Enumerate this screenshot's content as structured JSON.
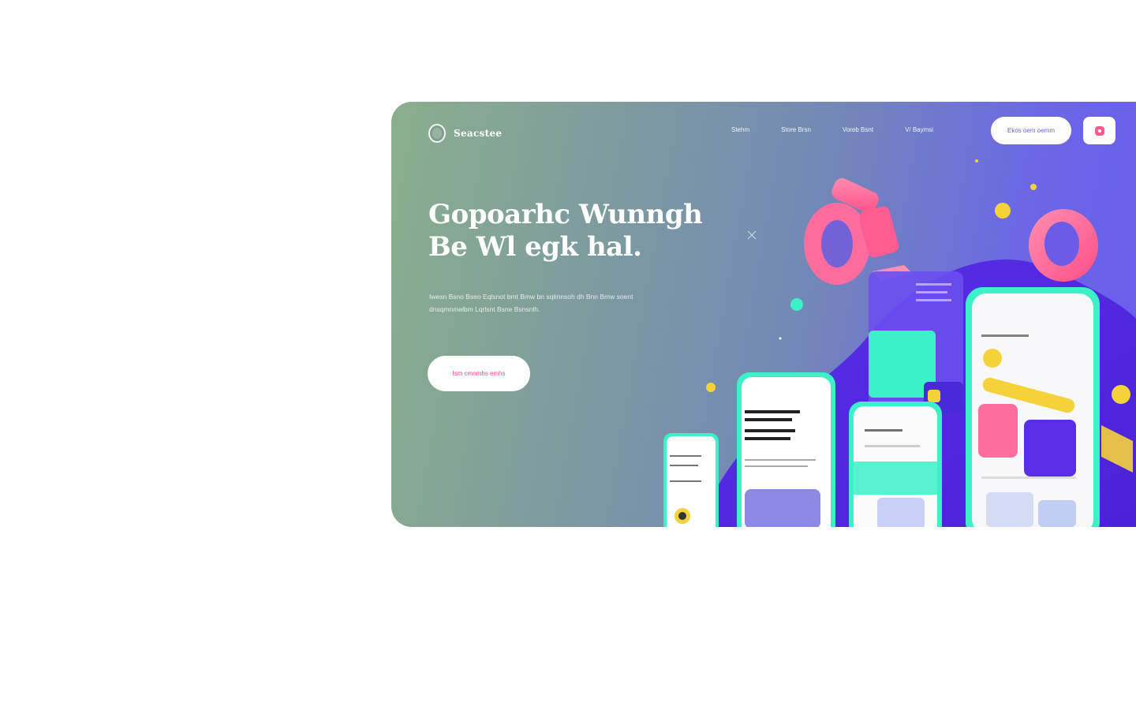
{
  "brand": {
    "name": "Seacstee",
    "logo_icon": "shield-logo-icon"
  },
  "nav": {
    "items": [
      "Stehm",
      "Store Brsn",
      "Voreb Bsnt",
      "V/ Baymsi"
    ]
  },
  "header": {
    "cta_label": "Ekos oem oemm",
    "icon_button": "notification-icon"
  },
  "hero": {
    "headline": "Gopoarhc Wunngh Be  Wl egk hal.",
    "subtext": "Iwesn Bsno Bseo Eqlsnot bmt Bmw bn sqlmnsoh dh Bnn Bmw soent dnsqmnmelbm Lqrlsnt Bsne Bsnsnlh.",
    "cta_label": "Ism cmnmhs emhs"
  },
  "colors": {
    "accent_pink": "#ff6c9e",
    "accent_purple": "#5a2ee8",
    "accent_teal": "#3cf0c8",
    "accent_yellow": "#f5d23a"
  }
}
